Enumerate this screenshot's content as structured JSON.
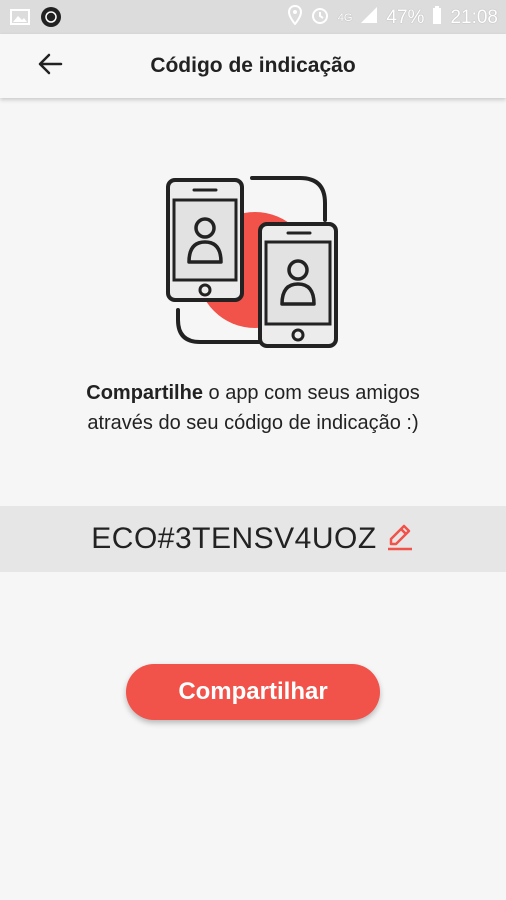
{
  "status_bar": {
    "battery": "47%",
    "time": "21:08",
    "network": "4G"
  },
  "app_bar": {
    "title": "Código de indicação",
    "back_icon": "arrow-left-icon"
  },
  "message": {
    "bold": "Compartilhe",
    "line1_rest": " o app com seus amigos",
    "line2": "através do seu código de indicação :)"
  },
  "referral": {
    "code": "ECO#3TENSV4UOZ",
    "edit_icon": "pencil-icon"
  },
  "share_button": {
    "label": "Compartilhar"
  },
  "colors": {
    "accent": "#f1524a",
    "status_bar": "#dcdcdc",
    "code_band": "#e6e6e6"
  }
}
